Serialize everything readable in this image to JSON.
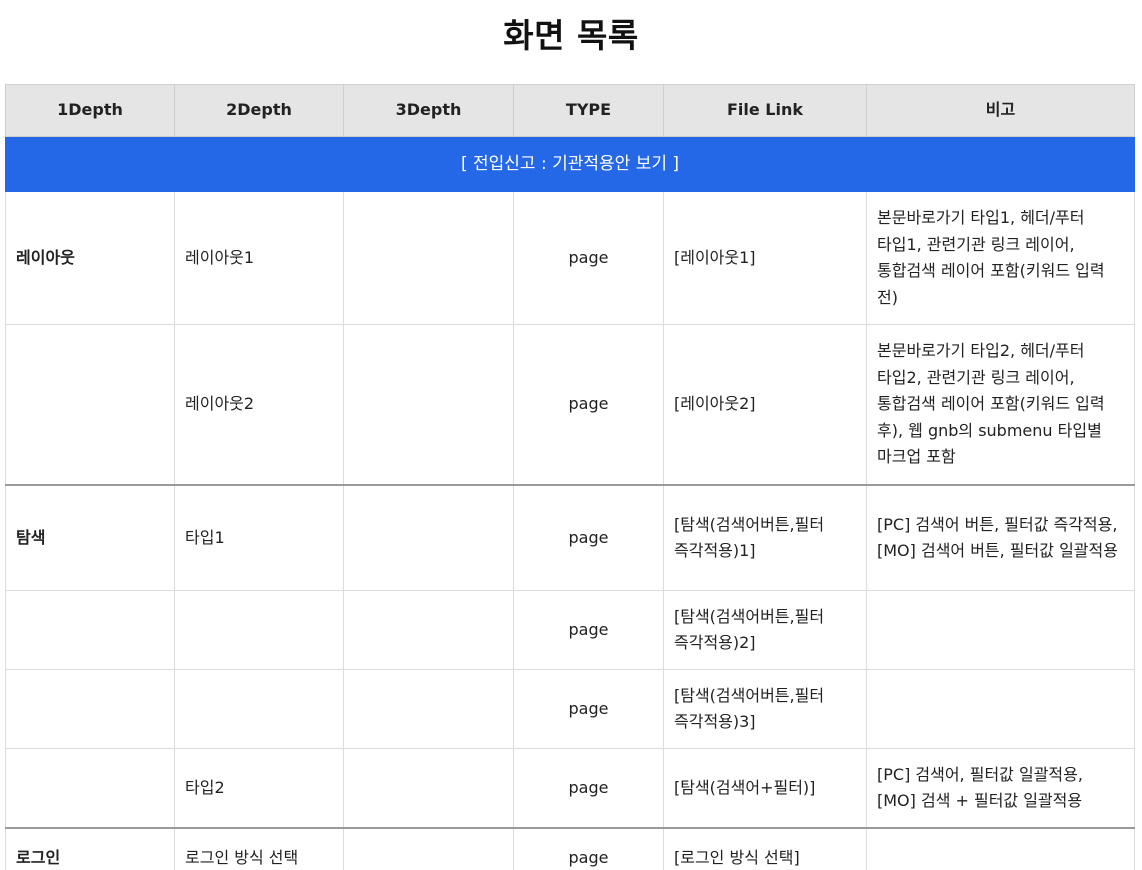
{
  "page": {
    "title": "화면 목록"
  },
  "table": {
    "headers": [
      "1Depth",
      "2Depth",
      "3Depth",
      "TYPE",
      "File Link",
      "비고"
    ],
    "banner": "[ 전입신고 : 기관적용안 보기 ]",
    "rows": [
      {
        "depth1": "레이아웃",
        "depth2": "레이아웃1",
        "depth3": "",
        "type": "page",
        "file_link": "[레이아웃1]",
        "note": "본문바로가기 타입1, 헤더/푸터 타입1, 관련기관 링크 레이어, 통합검색 레이어 포함(키워드 입력 전)"
      },
      {
        "depth1": "",
        "depth2": "레이아웃2",
        "depth3": "",
        "type": "page",
        "file_link": "[레이아웃2]",
        "note": "본문바로가기 타입2, 헤더/푸터 타입2, 관련기관 링크 레이어, 통합검색 레이어 포함(키워드 입력 후), 웹 gnb의 submenu 타입별 마크업 포함"
      },
      {
        "depth1": "탐색",
        "depth2": "타입1",
        "depth3": "",
        "type": "page",
        "file_link": "[탐색(검색어버튼,필터 즉각적용)1]",
        "note": "[PC] 검색어 버튼, 필터값 즉각적용, [MO] 검색어 버튼, 필터값 일괄적용"
      },
      {
        "depth1": "",
        "depth2": "",
        "depth3": "",
        "type": "page",
        "file_link": "[탐색(검색어버튼,필터 즉각적용)2]",
        "note": ""
      },
      {
        "depth1": "",
        "depth2": "",
        "depth3": "",
        "type": "page",
        "file_link": "[탐색(검색어버튼,필터 즉각적용)3]",
        "note": ""
      },
      {
        "depth1": "",
        "depth2": "타입2",
        "depth3": "",
        "type": "page",
        "file_link": "[탐색(검색어+필터)]",
        "note": "[PC] 검색어, 필터값 일괄적용, [MO] 검색 + 필터값 일괄적용"
      },
      {
        "depth1": "로그인",
        "depth2": "로그인 방식 선택",
        "depth3": "",
        "type": "page",
        "file_link": "[로그인 방식 선택]",
        "note": ""
      }
    ]
  }
}
